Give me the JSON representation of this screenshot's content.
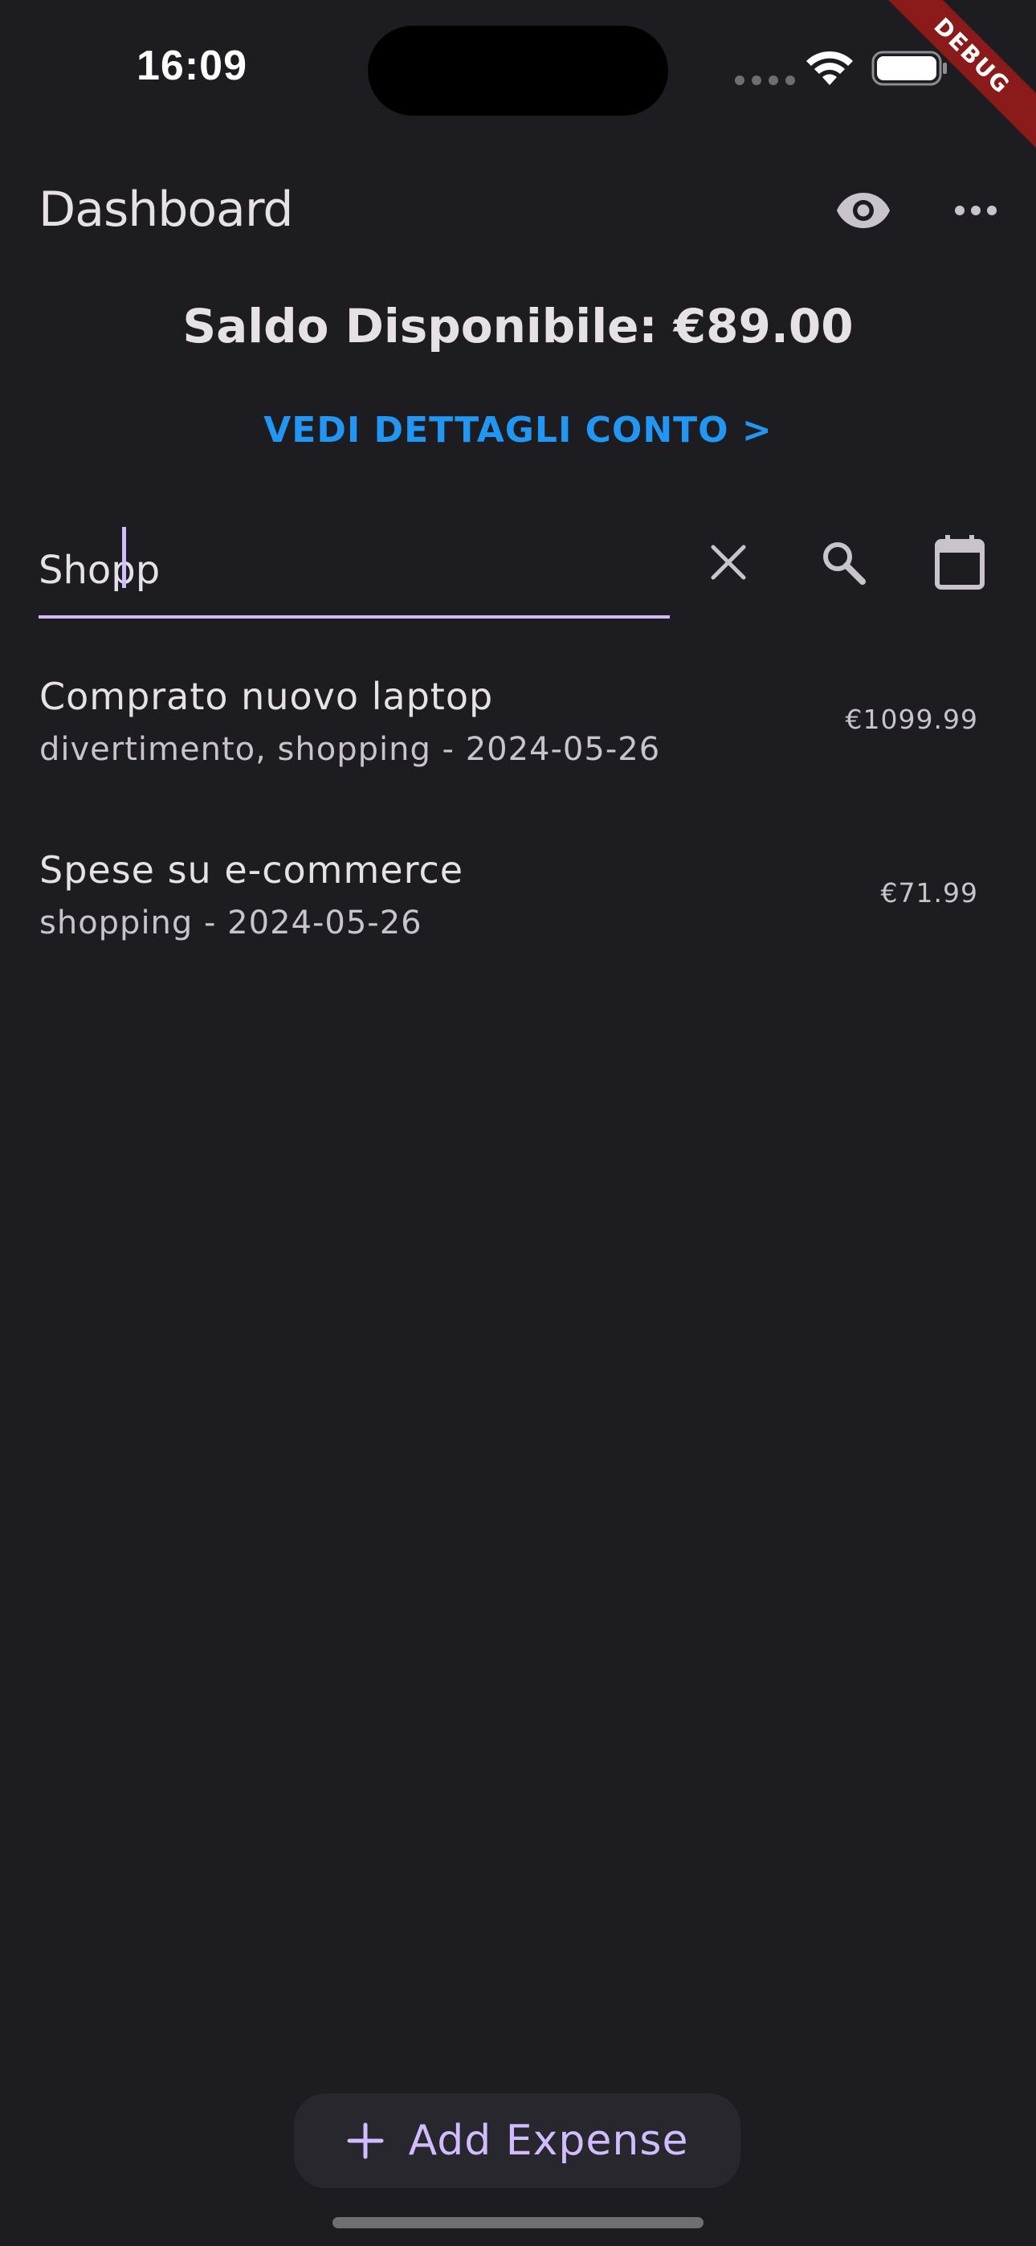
{
  "status_bar": {
    "time": "16:09",
    "debug_label": "DEBUG"
  },
  "app_bar": {
    "title": "Dashboard",
    "actions": [
      {
        "icon": "eye-icon"
      },
      {
        "icon": "more-horizontal-icon"
      }
    ]
  },
  "balance": {
    "text": "Saldo Disponibile: €89.00"
  },
  "details_link": {
    "label": "VEDI DETTAGLI CONTO >"
  },
  "search": {
    "value": "Shopp",
    "actions": [
      {
        "icon": "close-icon"
      },
      {
        "icon": "search-icon"
      },
      {
        "icon": "calendar-icon"
      }
    ]
  },
  "expenses": [
    {
      "title": "Comprato nuovo laptop",
      "subtitle": "divertimento, shopping - 2024-05-26",
      "amount": "€1099.99"
    },
    {
      "title": "Spese su e-commerce",
      "subtitle": "shopping - 2024-05-26",
      "amount": "€71.99"
    }
  ],
  "fab": {
    "icon": "plus-icon",
    "label": "Add Expense"
  },
  "colors": {
    "background": "#1d1c21",
    "accent": "#d0bcff",
    "link": "#2196f3",
    "debug_banner": "#8b1a1a"
  }
}
